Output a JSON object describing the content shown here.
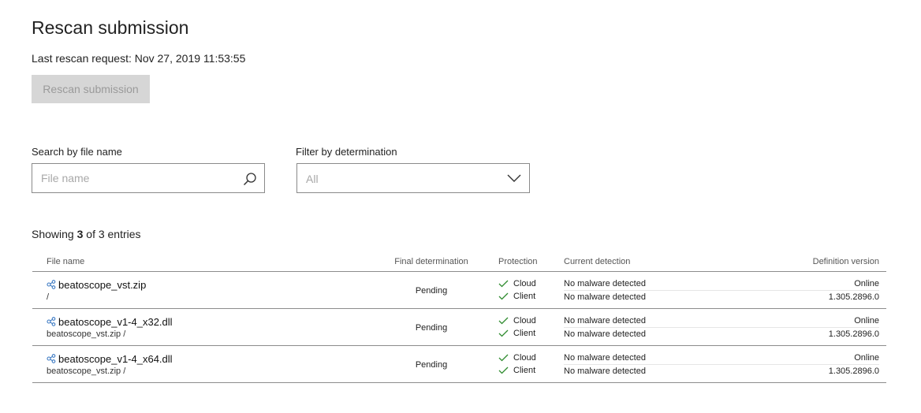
{
  "header": {
    "title": "Rescan submission",
    "last_rescan": "Last rescan request: Nov 27, 2019 11:53:55",
    "rescan_button": "Rescan submission"
  },
  "search": {
    "label": "Search by file name",
    "placeholder": "File name",
    "value": ""
  },
  "filter": {
    "label": "Filter by determination",
    "value": "All"
  },
  "entries": {
    "prefix": "Showing",
    "count": "3",
    "suffix": "of 3 entries"
  },
  "table": {
    "columns": {
      "file_name": "File name",
      "final_determination": "Final determination",
      "protection": "Protection",
      "current_detection": "Current detection",
      "definition_version": "Definition version"
    },
    "rows": [
      {
        "file_name": "beatoscope_vst.zip",
        "path": "/",
        "final_determination": "Pending",
        "protection": [
          "Cloud",
          "Client"
        ],
        "detection": [
          "No malware detected",
          "No malware detected"
        ],
        "definition": [
          "Online",
          "1.305.2896.0"
        ]
      },
      {
        "file_name": "beatoscope_v1-4_x32.dll",
        "path": "beatoscope_vst.zip /",
        "final_determination": "Pending",
        "protection": [
          "Cloud",
          "Client"
        ],
        "detection": [
          "No malware detected",
          "No malware detected"
        ],
        "definition": [
          "Online",
          "1.305.2896.0"
        ]
      },
      {
        "file_name": "beatoscope_v1-4_x64.dll",
        "path": "beatoscope_vst.zip /",
        "final_determination": "Pending",
        "protection": [
          "Cloud",
          "Client"
        ],
        "detection": [
          "No malware detected",
          "No malware detected"
        ],
        "definition": [
          "Online",
          "1.305.2896.0"
        ]
      }
    ]
  },
  "icons": {
    "search": "search-icon",
    "chevron": "chevron-down-icon",
    "file": "file-relation-icon",
    "check": "check-icon"
  },
  "colors": {
    "check": "#2e8b2e",
    "file_icon": "#3a78c2",
    "disabled_button_bg": "#d6d6d6",
    "disabled_button_text": "#9a9a9a"
  }
}
